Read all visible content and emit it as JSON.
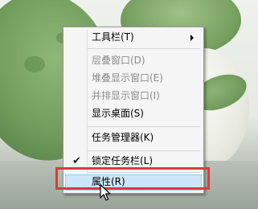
{
  "menu": {
    "items": [
      {
        "label": "工具栏(T)",
        "disabled": false,
        "submenu": true
      },
      {
        "label": "层叠窗口(D)",
        "disabled": true
      },
      {
        "label": "堆叠显示窗口(E)",
        "disabled": true
      },
      {
        "label": "并排显示窗口(I)",
        "disabled": true
      },
      {
        "label": "显示桌面(S)",
        "disabled": false
      },
      {
        "label": "任务管理器(K)",
        "disabled": false
      },
      {
        "label": "锁定任务栏(L)",
        "disabled": false,
        "checked": true
      },
      {
        "label": "属性(R)",
        "disabled": false,
        "hovered": true
      }
    ],
    "check_glyph": "✔"
  },
  "highlight_color": "#e0383b",
  "hover_color": "#cde6f7"
}
